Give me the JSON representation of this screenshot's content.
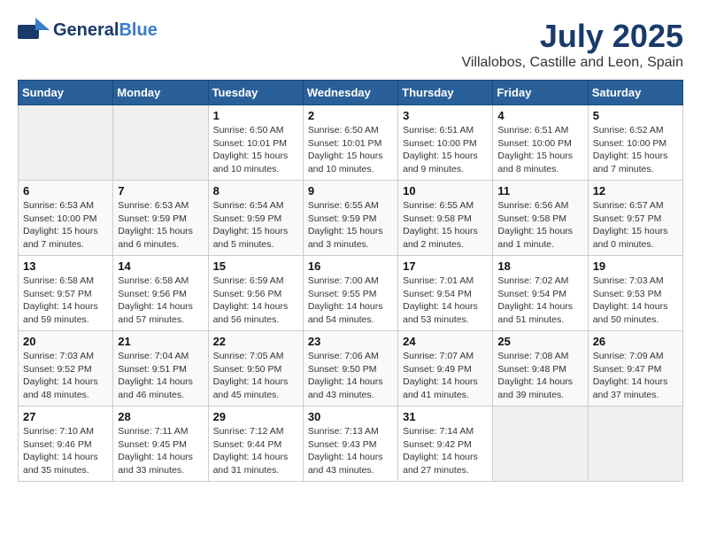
{
  "header": {
    "logo_line1": "General",
    "logo_line2": "Blue",
    "month_title": "July 2025",
    "location": "Villalobos, Castille and Leon, Spain"
  },
  "calendar": {
    "weekdays": [
      "Sunday",
      "Monday",
      "Tuesday",
      "Wednesday",
      "Thursday",
      "Friday",
      "Saturday"
    ],
    "weeks": [
      [
        {
          "day": "",
          "empty": true
        },
        {
          "day": "",
          "empty": true
        },
        {
          "day": "1",
          "sunrise": "Sunrise: 6:50 AM",
          "sunset": "Sunset: 10:01 PM",
          "daylight": "Daylight: 15 hours and 10 minutes."
        },
        {
          "day": "2",
          "sunrise": "Sunrise: 6:50 AM",
          "sunset": "Sunset: 10:01 PM",
          "daylight": "Daylight: 15 hours and 10 minutes."
        },
        {
          "day": "3",
          "sunrise": "Sunrise: 6:51 AM",
          "sunset": "Sunset: 10:00 PM",
          "daylight": "Daylight: 15 hours and 9 minutes."
        },
        {
          "day": "4",
          "sunrise": "Sunrise: 6:51 AM",
          "sunset": "Sunset: 10:00 PM",
          "daylight": "Daylight: 15 hours and 8 minutes."
        },
        {
          "day": "5",
          "sunrise": "Sunrise: 6:52 AM",
          "sunset": "Sunset: 10:00 PM",
          "daylight": "Daylight: 15 hours and 7 minutes."
        }
      ],
      [
        {
          "day": "6",
          "sunrise": "Sunrise: 6:53 AM",
          "sunset": "Sunset: 10:00 PM",
          "daylight": "Daylight: 15 hours and 7 minutes."
        },
        {
          "day": "7",
          "sunrise": "Sunrise: 6:53 AM",
          "sunset": "Sunset: 9:59 PM",
          "daylight": "Daylight: 15 hours and 6 minutes."
        },
        {
          "day": "8",
          "sunrise": "Sunrise: 6:54 AM",
          "sunset": "Sunset: 9:59 PM",
          "daylight": "Daylight: 15 hours and 5 minutes."
        },
        {
          "day": "9",
          "sunrise": "Sunrise: 6:55 AM",
          "sunset": "Sunset: 9:59 PM",
          "daylight": "Daylight: 15 hours and 3 minutes."
        },
        {
          "day": "10",
          "sunrise": "Sunrise: 6:55 AM",
          "sunset": "Sunset: 9:58 PM",
          "daylight": "Daylight: 15 hours and 2 minutes."
        },
        {
          "day": "11",
          "sunrise": "Sunrise: 6:56 AM",
          "sunset": "Sunset: 9:58 PM",
          "daylight": "Daylight: 15 hours and 1 minute."
        },
        {
          "day": "12",
          "sunrise": "Sunrise: 6:57 AM",
          "sunset": "Sunset: 9:57 PM",
          "daylight": "Daylight: 15 hours and 0 minutes."
        }
      ],
      [
        {
          "day": "13",
          "sunrise": "Sunrise: 6:58 AM",
          "sunset": "Sunset: 9:57 PM",
          "daylight": "Daylight: 14 hours and 59 minutes."
        },
        {
          "day": "14",
          "sunrise": "Sunrise: 6:58 AM",
          "sunset": "Sunset: 9:56 PM",
          "daylight": "Daylight: 14 hours and 57 minutes."
        },
        {
          "day": "15",
          "sunrise": "Sunrise: 6:59 AM",
          "sunset": "Sunset: 9:56 PM",
          "daylight": "Daylight: 14 hours and 56 minutes."
        },
        {
          "day": "16",
          "sunrise": "Sunrise: 7:00 AM",
          "sunset": "Sunset: 9:55 PM",
          "daylight": "Daylight: 14 hours and 54 minutes."
        },
        {
          "day": "17",
          "sunrise": "Sunrise: 7:01 AM",
          "sunset": "Sunset: 9:54 PM",
          "daylight": "Daylight: 14 hours and 53 minutes."
        },
        {
          "day": "18",
          "sunrise": "Sunrise: 7:02 AM",
          "sunset": "Sunset: 9:54 PM",
          "daylight": "Daylight: 14 hours and 51 minutes."
        },
        {
          "day": "19",
          "sunrise": "Sunrise: 7:03 AM",
          "sunset": "Sunset: 9:53 PM",
          "daylight": "Daylight: 14 hours and 50 minutes."
        }
      ],
      [
        {
          "day": "20",
          "sunrise": "Sunrise: 7:03 AM",
          "sunset": "Sunset: 9:52 PM",
          "daylight": "Daylight: 14 hours and 48 minutes."
        },
        {
          "day": "21",
          "sunrise": "Sunrise: 7:04 AM",
          "sunset": "Sunset: 9:51 PM",
          "daylight": "Daylight: 14 hours and 46 minutes."
        },
        {
          "day": "22",
          "sunrise": "Sunrise: 7:05 AM",
          "sunset": "Sunset: 9:50 PM",
          "daylight": "Daylight: 14 hours and 45 minutes."
        },
        {
          "day": "23",
          "sunrise": "Sunrise: 7:06 AM",
          "sunset": "Sunset: 9:50 PM",
          "daylight": "Daylight: 14 hours and 43 minutes."
        },
        {
          "day": "24",
          "sunrise": "Sunrise: 7:07 AM",
          "sunset": "Sunset: 9:49 PM",
          "daylight": "Daylight: 14 hours and 41 minutes."
        },
        {
          "day": "25",
          "sunrise": "Sunrise: 7:08 AM",
          "sunset": "Sunset: 9:48 PM",
          "daylight": "Daylight: 14 hours and 39 minutes."
        },
        {
          "day": "26",
          "sunrise": "Sunrise: 7:09 AM",
          "sunset": "Sunset: 9:47 PM",
          "daylight": "Daylight: 14 hours and 37 minutes."
        }
      ],
      [
        {
          "day": "27",
          "sunrise": "Sunrise: 7:10 AM",
          "sunset": "Sunset: 9:46 PM",
          "daylight": "Daylight: 14 hours and 35 minutes."
        },
        {
          "day": "28",
          "sunrise": "Sunrise: 7:11 AM",
          "sunset": "Sunset: 9:45 PM",
          "daylight": "Daylight: 14 hours and 33 minutes."
        },
        {
          "day": "29",
          "sunrise": "Sunrise: 7:12 AM",
          "sunset": "Sunset: 9:44 PM",
          "daylight": "Daylight: 14 hours and 31 minutes."
        },
        {
          "day": "30",
          "sunrise": "Sunrise: 7:13 AM",
          "sunset": "Sunset: 9:43 PM",
          "daylight": "Daylight: 14 hours and 43 minutes."
        },
        {
          "day": "31",
          "sunrise": "Sunrise: 7:14 AM",
          "sunset": "Sunset: 9:42 PM",
          "daylight": "Daylight: 14 hours and 27 minutes."
        },
        {
          "day": "",
          "empty": true
        },
        {
          "day": "",
          "empty": true
        }
      ]
    ]
  }
}
